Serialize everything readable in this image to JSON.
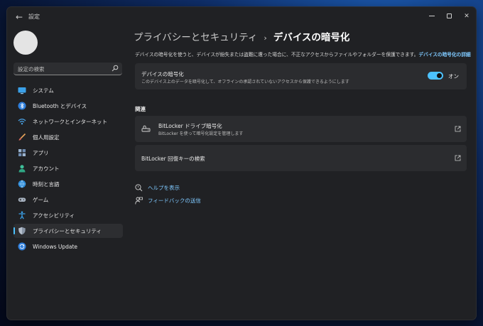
{
  "window": {
    "app_title": "設定",
    "back_glyph": "←",
    "close_glyph": "✕"
  },
  "sidebar": {
    "search_placeholder": "設定の検索",
    "items": [
      {
        "label": "システム",
        "icon": "monitor-icon"
      },
      {
        "label": "Bluetooth とデバイス",
        "icon": "bluetooth-icon"
      },
      {
        "label": "ネットワークとインターネット",
        "icon": "wifi-icon"
      },
      {
        "label": "個人用設定",
        "icon": "brush-icon"
      },
      {
        "label": "アプリ",
        "icon": "apps-icon"
      },
      {
        "label": "アカウント",
        "icon": "person-icon"
      },
      {
        "label": "時刻と言語",
        "icon": "globe-clock-icon"
      },
      {
        "label": "ゲーム",
        "icon": "gamepad-icon"
      },
      {
        "label": "アクセシビリティ",
        "icon": "accessibility-icon"
      },
      {
        "label": "プライバシーとセキュリティ",
        "icon": "shield-icon",
        "active": true
      },
      {
        "label": "Windows Update",
        "icon": "update-icon"
      }
    ]
  },
  "main": {
    "breadcrumb_parent": "プライバシーとセキュリティ",
    "breadcrumb_sep": "›",
    "breadcrumb_current": "デバイスの暗号化",
    "description": "デバイスの暗号化を使うと、デバイスが紛失または盗難に遭った場合に、不正なアクセスからファイルやフォルダーを保護できます。",
    "description_link": "デバイスの暗号化の詳細",
    "encryption_card": {
      "title": "デバイスの暗号化",
      "subtitle": "このデバイス上のデータを暗号化して、オフラインの承認されていないアクセスから保護できるようにします",
      "toggle_state": "オン",
      "toggle_on": true
    },
    "related_label": "関連",
    "bitlocker_card": {
      "title": "BitLocker ドライブ暗号化",
      "subtitle": "BitLocker を使って暗号化設定を管理します"
    },
    "recovery_card": {
      "title": "BitLocker 回復キーの検索"
    },
    "help_link": "ヘルプを表示",
    "feedback_link": "フィードバックの送信"
  },
  "colors": {
    "accent": "#4cc2ff",
    "window_bg": "#202124",
    "card_bg": "#2b2c2f",
    "link": "#7fc9ff"
  }
}
